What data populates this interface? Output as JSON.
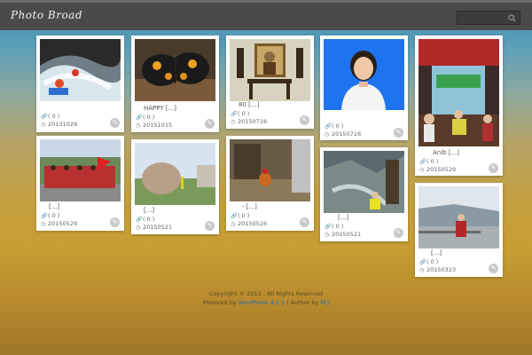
{
  "header": {
    "logo": "Photo Broad",
    "search_placeholder": ""
  },
  "posts": [
    {
      "title": "",
      "count": "( 0 )",
      "date": "20131029"
    },
    {
      "title": "HAPPY [...]",
      "count": "( 0 )",
      "date": "20151015"
    },
    {
      "title": "80 [...]",
      "count": "( 0 )",
      "date": "20150716"
    },
    {
      "title": "",
      "count": "( 0 )",
      "date": "20150716"
    },
    {
      "title": "Anib [...]",
      "count": "( 0 )",
      "date": "20150529"
    },
    {
      "title": "[...]",
      "count": "( 0 )",
      "date": "20150529"
    },
    {
      "title": "[...]",
      "count": "( 0 )",
      "date": "20150521"
    },
    {
      "title": "- [...]",
      "count": "( 0 )",
      "date": "20150526"
    },
    {
      "title": "[...]",
      "count": "( 0 )",
      "date": "20150521"
    },
    {
      "title": "[...]",
      "count": "( 0 )",
      "date": "20150323"
    }
  ],
  "footer": {
    "copyright": "Copyright © 2015 . All Rights Reserved",
    "powered_prefix": "Powered by",
    "powered_link": "WordPress 4.2.1",
    "author_prefix": "| Author by",
    "author_link": "M.J"
  }
}
